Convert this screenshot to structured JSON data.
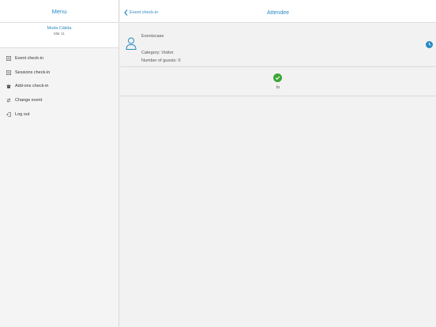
{
  "sidebar": {
    "title": "Menu",
    "event": {
      "name": "Moda Cálida",
      "date": "Mär 11"
    },
    "items": [
      {
        "label": "Event check-in",
        "icon": "list-icon"
      },
      {
        "label": "Sessions check-in",
        "icon": "list-icon"
      },
      {
        "label": "Add-ons check-in",
        "icon": "gift-icon"
      },
      {
        "label": "Change event",
        "icon": "swap-icon"
      },
      {
        "label": "Log out",
        "icon": "logout-icon"
      }
    ]
  },
  "topbar": {
    "back_label": "Event check-in",
    "title": "Attendee"
  },
  "attendee": {
    "name": "Eventscase",
    "category": "Category: Visitor",
    "guests": "Number of guests: 0"
  },
  "status": {
    "label": "In"
  },
  "colors": {
    "accent": "#2a8bc2",
    "success": "#3aa635",
    "background": "#f2f2f2"
  }
}
